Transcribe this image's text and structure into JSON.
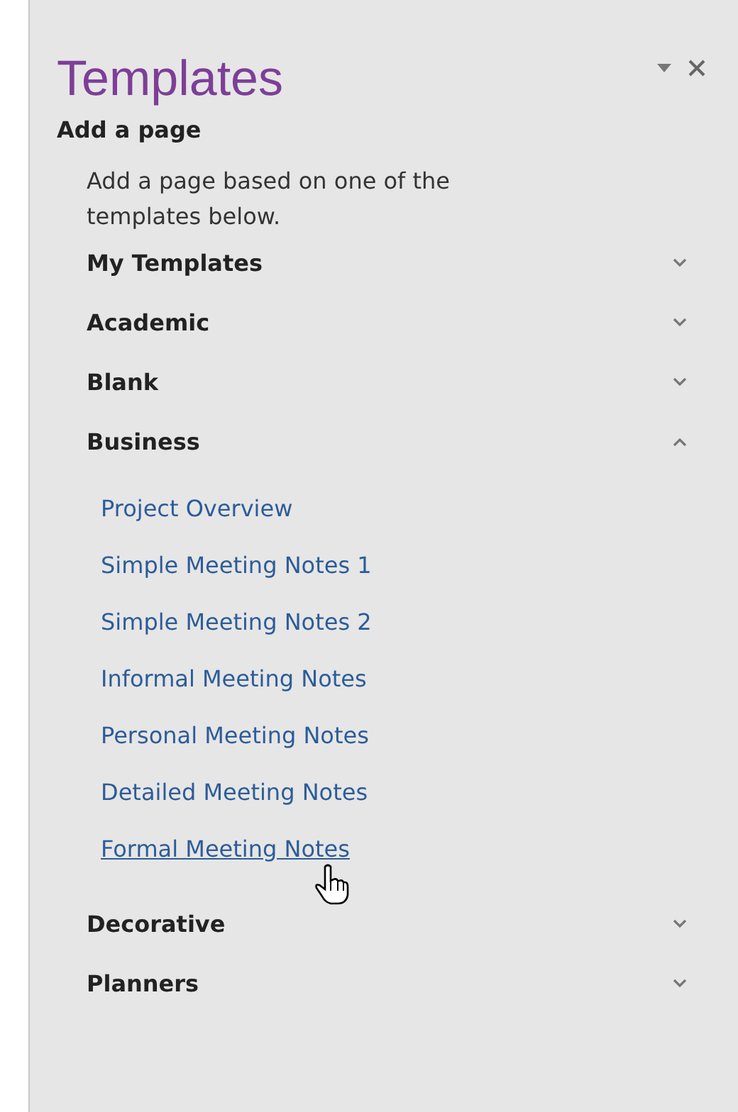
{
  "pane": {
    "title": "Templates",
    "subtitle": "Add a page",
    "description": "Add a page based on one of the templates below."
  },
  "sections": [
    {
      "label": "My Templates",
      "expanded": false
    },
    {
      "label": "Academic",
      "expanded": false
    },
    {
      "label": "Blank",
      "expanded": false
    },
    {
      "label": "Business",
      "expanded": true,
      "items": [
        {
          "label": "Project Overview",
          "hovered": false
        },
        {
          "label": "Simple Meeting Notes 1",
          "hovered": false
        },
        {
          "label": "Simple Meeting Notes 2",
          "hovered": false
        },
        {
          "label": "Informal Meeting Notes",
          "hovered": false
        },
        {
          "label": "Personal Meeting Notes",
          "hovered": false
        },
        {
          "label": "Detailed Meeting Notes",
          "hovered": false
        },
        {
          "label": "Formal Meeting Notes",
          "hovered": true
        }
      ]
    },
    {
      "label": "Decorative",
      "expanded": false
    },
    {
      "label": "Planners",
      "expanded": false
    }
  ]
}
